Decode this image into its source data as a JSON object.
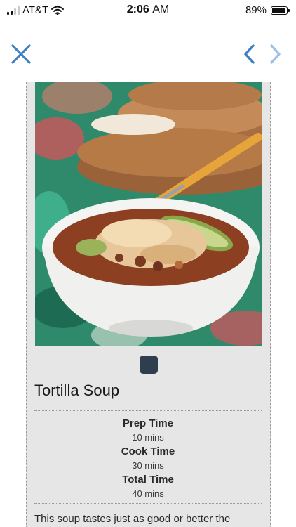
{
  "status_bar": {
    "carrier": "AT&T",
    "time": "2:06",
    "ampm": "AM",
    "battery_percent": "89%",
    "battery_level": 0.89
  },
  "nav": {
    "close_icon": "close-x-icon",
    "prev_icon": "chevron-left-icon",
    "next_icon": "chevron-right-icon",
    "accent_color": "#3d7fc4",
    "disabled_color": "#9cc3e6"
  },
  "recipe": {
    "title": "Tortilla Soup",
    "prep_label": "Prep Time",
    "prep_value": "10 mins",
    "cook_label": "Cook Time",
    "cook_value": "30 mins",
    "total_label": "Total Time",
    "total_value": "40 mins",
    "description": "This soup tastes just as good or better the"
  },
  "colors": {
    "card_background": "#e6e6e6",
    "slider_dot": "#2f3e4f"
  }
}
